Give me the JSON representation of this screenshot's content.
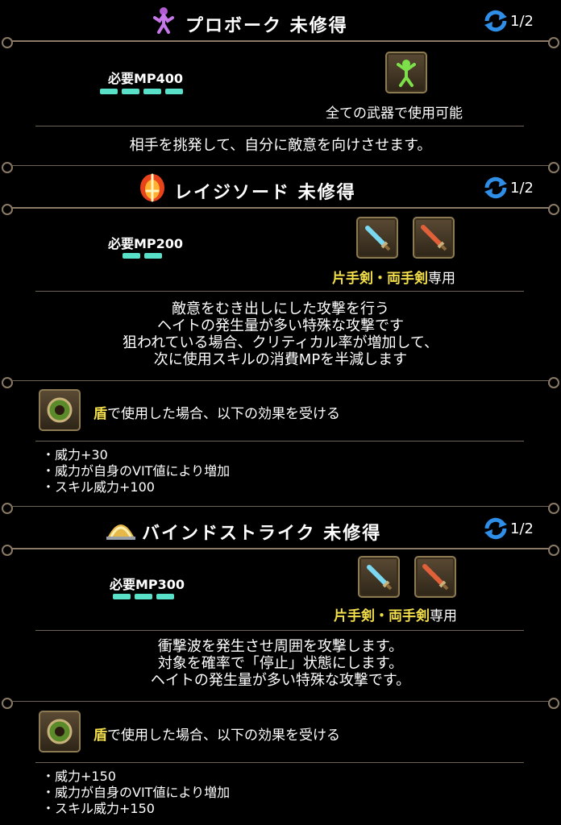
{
  "skills": [
    {
      "title": "プロボーク 未修得",
      "page": "1/2",
      "mp_label": "必要MP400",
      "mp_cost": 4,
      "weapon_text": "全ての武器で使用可能",
      "description": [
        "相手を挑発して、自分に敵意を向けさせます。"
      ]
    },
    {
      "title": "レイジソード 未修得",
      "page": "1/2",
      "mp_label": "必要MP200",
      "mp_cost": 2,
      "weapon_yellow": "片手剣・両手剣",
      "weapon_white": "専用",
      "description": [
        "敵意をむき出しにした攻撃を行う",
        "ヘイトの発生量が多い特殊な攻撃です",
        "狙われている場合、クリティカル率が増加して、",
        "次に使用スキルの消費MPを半減します"
      ],
      "shield_yellow": "盾",
      "shield_white": "で使用した場合、以下の効果を受ける",
      "effects": [
        "・威力+30",
        "・威力が自身のVIT値により増加",
        "・スキル威力+100"
      ]
    },
    {
      "title": "バインドストライク 未修得",
      "page": "1/2",
      "mp_label": "必要MP300",
      "mp_cost": 3,
      "weapon_yellow": "片手剣・両手剣",
      "weapon_white": "専用",
      "description": [
        "衝撃波を発生させ周囲を攻撃します。",
        "対象を確率で「停止」状態にします。",
        "ヘイトの発生量が多い特殊な攻撃です。"
      ],
      "shield_yellow": "盾",
      "shield_white": "で使用した場合、以下の効果を受ける",
      "effects": [
        "・威力+150",
        "・威力が自身のVIT値により増加",
        "・スキル威力+150"
      ]
    }
  ]
}
